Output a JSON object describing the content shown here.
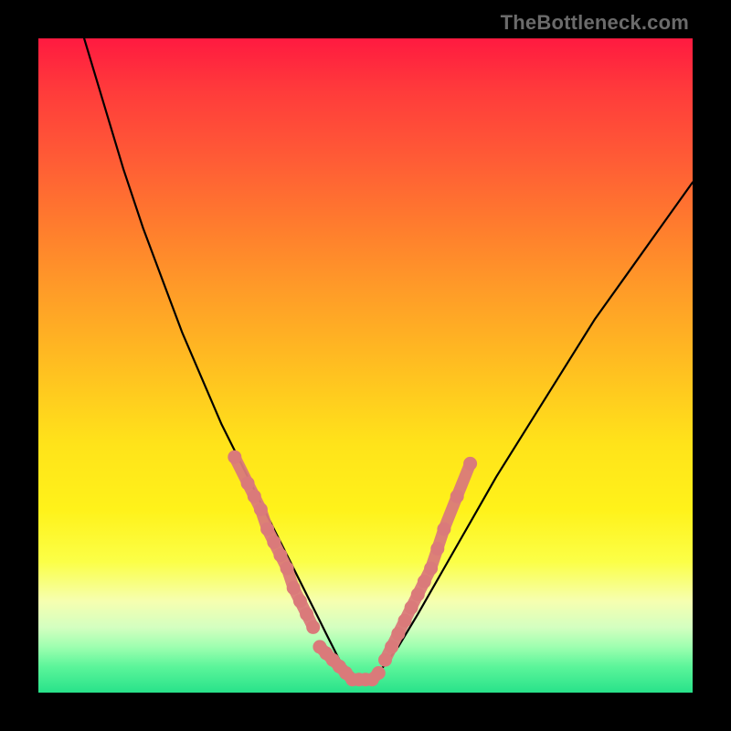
{
  "attribution": "TheBottleneck.com",
  "chart_data": {
    "type": "line",
    "title": "",
    "xlabel": "",
    "ylabel": "",
    "xlim": [
      0,
      100
    ],
    "ylim": [
      0,
      100
    ],
    "series": [
      {
        "name": "bottleneck-curve",
        "x": [
          7,
          10,
          13,
          16,
          19,
          22,
          25,
          28,
          31,
          34,
          36,
          38,
          40,
          42,
          43,
          44,
          45,
          46,
          47,
          48,
          49,
          50,
          52,
          55,
          58,
          62,
          66,
          70,
          75,
          80,
          85,
          90,
          95,
          100
        ],
        "values": [
          100,
          90,
          80,
          71,
          63,
          55,
          48,
          41,
          35,
          29,
          25,
          21,
          17,
          13,
          11,
          9,
          7,
          5,
          4,
          3,
          2,
          2,
          3,
          7,
          12,
          19,
          26,
          33,
          41,
          49,
          57,
          64,
          71,
          78
        ]
      }
    ],
    "highlight_clusters": [
      {
        "name": "left-branch-points",
        "points": [
          {
            "x": 30,
            "y": 36
          },
          {
            "x": 32,
            "y": 32
          },
          {
            "x": 33,
            "y": 30
          },
          {
            "x": 34,
            "y": 28
          },
          {
            "x": 35,
            "y": 25
          },
          {
            "x": 36,
            "y": 23
          },
          {
            "x": 37,
            "y": 21
          },
          {
            "x": 38,
            "y": 19
          },
          {
            "x": 39,
            "y": 16
          },
          {
            "x": 40,
            "y": 14
          },
          {
            "x": 41,
            "y": 12
          },
          {
            "x": 42,
            "y": 10
          }
        ]
      },
      {
        "name": "valley-floor-points",
        "points": [
          {
            "x": 43,
            "y": 7
          },
          {
            "x": 44,
            "y": 6
          },
          {
            "x": 45,
            "y": 5
          },
          {
            "x": 46,
            "y": 4
          },
          {
            "x": 47,
            "y": 3
          },
          {
            "x": 48,
            "y": 2
          },
          {
            "x": 49,
            "y": 2
          },
          {
            "x": 50,
            "y": 2
          },
          {
            "x": 51,
            "y": 2
          },
          {
            "x": 52,
            "y": 3
          }
        ]
      },
      {
        "name": "right-branch-points",
        "points": [
          {
            "x": 53,
            "y": 5
          },
          {
            "x": 54,
            "y": 7
          },
          {
            "x": 55,
            "y": 9
          },
          {
            "x": 56,
            "y": 11
          },
          {
            "x": 57,
            "y": 13
          },
          {
            "x": 58,
            "y": 15
          },
          {
            "x": 59,
            "y": 17
          },
          {
            "x": 60,
            "y": 19
          },
          {
            "x": 61,
            "y": 22
          },
          {
            "x": 62,
            "y": 25
          },
          {
            "x": 64,
            "y": 30
          },
          {
            "x": 66,
            "y": 35
          }
        ]
      }
    ]
  }
}
